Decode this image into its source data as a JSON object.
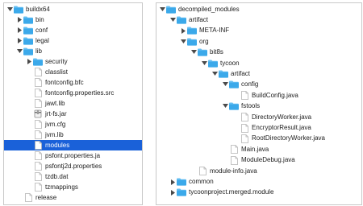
{
  "colors": {
    "folder": "#3ba9ea",
    "folder_tab": "#66bff2",
    "selection": "#1a61d9",
    "chevron": "#4a4a4a",
    "file_fill": "#ffffff",
    "file_stroke": "#b4b4b4",
    "border": "#c9c9c9"
  },
  "left_tree": {
    "items": [
      {
        "label": "buildx64",
        "type": "folder",
        "state": "expanded",
        "indent": 0,
        "selected": false
      },
      {
        "label": "bin",
        "type": "folder",
        "state": "collapsed",
        "indent": 1,
        "selected": false
      },
      {
        "label": "conf",
        "type": "folder",
        "state": "collapsed",
        "indent": 1,
        "selected": false
      },
      {
        "label": "legal",
        "type": "folder",
        "state": "collapsed",
        "indent": 1,
        "selected": false
      },
      {
        "label": "lib",
        "type": "folder",
        "state": "expanded",
        "indent": 1,
        "selected": false
      },
      {
        "label": "security",
        "type": "folder",
        "state": "collapsed",
        "indent": 2,
        "selected": false
      },
      {
        "label": "classlist",
        "type": "file",
        "state": "none",
        "indent": 2,
        "selected": false
      },
      {
        "label": "fontconfig.bfc",
        "type": "file",
        "state": "none",
        "indent": 2,
        "selected": false
      },
      {
        "label": "fontconfig.properties.src",
        "type": "file",
        "state": "none",
        "indent": 2,
        "selected": false
      },
      {
        "label": "jawt.lib",
        "type": "file",
        "state": "none",
        "indent": 2,
        "selected": false
      },
      {
        "label": "jrt-fs.jar",
        "type": "jar",
        "state": "none",
        "indent": 2,
        "selected": false
      },
      {
        "label": "jvm.cfg",
        "type": "file",
        "state": "none",
        "indent": 2,
        "selected": false
      },
      {
        "label": "jvm.lib",
        "type": "file",
        "state": "none",
        "indent": 2,
        "selected": false
      },
      {
        "label": "modules",
        "type": "file",
        "state": "none",
        "indent": 2,
        "selected": true
      },
      {
        "label": "psfont.properties.ja",
        "type": "file",
        "state": "none",
        "indent": 2,
        "selected": false
      },
      {
        "label": "psfontj2d.properties",
        "type": "file",
        "state": "none",
        "indent": 2,
        "selected": false
      },
      {
        "label": "tzdb.dat",
        "type": "file",
        "state": "none",
        "indent": 2,
        "selected": false
      },
      {
        "label": "tzmappings",
        "type": "file",
        "state": "none",
        "indent": 2,
        "selected": false
      },
      {
        "label": "release",
        "type": "file",
        "state": "none",
        "indent": 1,
        "selected": false
      }
    ]
  },
  "right_tree": {
    "items": [
      {
        "label": "decompiled_modules",
        "type": "folder",
        "state": "expanded",
        "indent": 0,
        "selected": false
      },
      {
        "label": "artifact",
        "type": "folder",
        "state": "expanded",
        "indent": 1,
        "selected": false
      },
      {
        "label": "META-INF",
        "type": "folder",
        "state": "collapsed",
        "indent": 2,
        "selected": false
      },
      {
        "label": "org",
        "type": "folder",
        "state": "expanded",
        "indent": 2,
        "selected": false
      },
      {
        "label": "bit8s",
        "type": "folder",
        "state": "expanded",
        "indent": 3,
        "selected": false
      },
      {
        "label": "tycoon",
        "type": "folder",
        "state": "expanded",
        "indent": 4,
        "selected": false
      },
      {
        "label": "artifact",
        "type": "folder",
        "state": "expanded",
        "indent": 5,
        "selected": false
      },
      {
        "label": "config",
        "type": "folder",
        "state": "expanded",
        "indent": 6,
        "selected": false
      },
      {
        "label": "BuildConfig.java",
        "type": "file",
        "state": "none",
        "indent": 7,
        "selected": false
      },
      {
        "label": "fstools",
        "type": "folder",
        "state": "expanded",
        "indent": 6,
        "selected": false
      },
      {
        "label": "DirectoryWorker.java",
        "type": "file",
        "state": "none",
        "indent": 7,
        "selected": false
      },
      {
        "label": "EncryptorResult.java",
        "type": "file",
        "state": "none",
        "indent": 7,
        "selected": false
      },
      {
        "label": "RootDirectoryWorker.java",
        "type": "file",
        "state": "none",
        "indent": 7,
        "selected": false
      },
      {
        "label": "Main.java",
        "type": "file",
        "state": "none",
        "indent": 6,
        "selected": false
      },
      {
        "label": "ModuleDebug.java",
        "type": "file",
        "state": "none",
        "indent": 6,
        "selected": false
      },
      {
        "label": "module-info.java",
        "type": "file",
        "state": "none",
        "indent": 3,
        "selected": false
      },
      {
        "label": "common",
        "type": "folder",
        "state": "collapsed",
        "indent": 1,
        "selected": false
      },
      {
        "label": "tycoonproject.merged.module",
        "type": "folder",
        "state": "collapsed",
        "indent": 1,
        "selected": false
      }
    ]
  }
}
